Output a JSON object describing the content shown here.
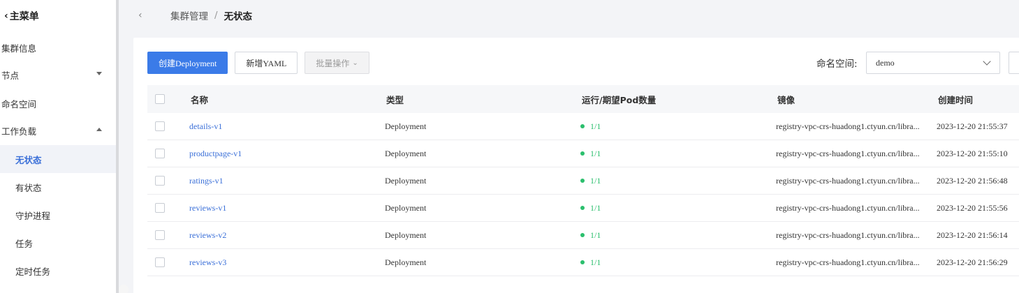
{
  "sidebar": {
    "title": "主菜单",
    "items": [
      {
        "label": "集群信息"
      },
      {
        "label": "节点"
      },
      {
        "label": "命名空间"
      },
      {
        "label": "工作负载"
      },
      {
        "label": "无状态"
      },
      {
        "label": "有状态"
      },
      {
        "label": "守护进程"
      },
      {
        "label": "任务"
      },
      {
        "label": "定时任务"
      }
    ]
  },
  "header": {
    "breadcrumb_parent": "集群管理",
    "separator": "/",
    "breadcrumb_current": "无状态"
  },
  "toolbar": {
    "create_label": "创建Deployment",
    "add_yaml_label": "新增YAML",
    "batch_label": "批量操作",
    "namespace_label": "命名空间:",
    "namespace_value": "demo"
  },
  "table": {
    "columns": [
      "名称",
      "类型",
      "运行/期望Pod数量",
      "镜像",
      "创建时间"
    ],
    "rows": [
      {
        "name": "details-v1",
        "type": "Deployment",
        "pods": "1/1",
        "image": "registry-vpc-crs-huadong1.ctyun.cn/libra...",
        "created": "2023-12-20 21:55:37"
      },
      {
        "name": "productpage-v1",
        "type": "Deployment",
        "pods": "1/1",
        "image": "registry-vpc-crs-huadong1.ctyun.cn/libra...",
        "created": "2023-12-20 21:55:10"
      },
      {
        "name": "ratings-v1",
        "type": "Deployment",
        "pods": "1/1",
        "image": "registry-vpc-crs-huadong1.ctyun.cn/libra...",
        "created": "2023-12-20 21:56:48"
      },
      {
        "name": "reviews-v1",
        "type": "Deployment",
        "pods": "1/1",
        "image": "registry-vpc-crs-huadong1.ctyun.cn/libra...",
        "created": "2023-12-20 21:55:56"
      },
      {
        "name": "reviews-v2",
        "type": "Deployment",
        "pods": "1/1",
        "image": "registry-vpc-crs-huadong1.ctyun.cn/libra...",
        "created": "2023-12-20 21:56:14"
      },
      {
        "name": "reviews-v3",
        "type": "Deployment",
        "pods": "1/1",
        "image": "registry-vpc-crs-huadong1.ctyun.cn/libra...",
        "created": "2023-12-20 21:56:29"
      }
    ]
  },
  "colors": {
    "accent": "#3a6fd8",
    "primary_button": "#3b7be8",
    "status_running": "#2bbf6d"
  }
}
